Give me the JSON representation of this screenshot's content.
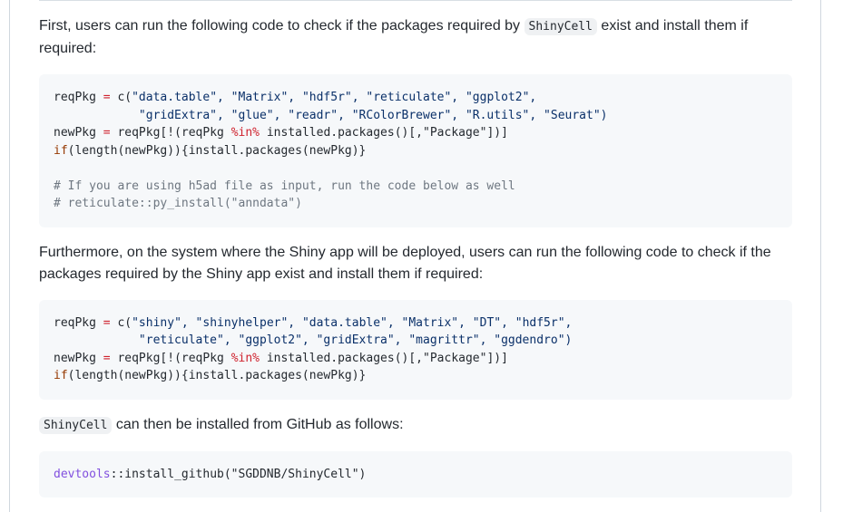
{
  "para1": {
    "before": "First, users can run the following code to check if the packages required by",
    "code": "ShinyCell",
    "after": "exist and install them if required:"
  },
  "block1": {
    "l1_a": "reqPkg",
    "l1_b": " = ",
    "l1_c": "c(",
    "l1_d": "\"data.table\", \"Matrix\", \"hdf5r\", \"reticulate\", \"ggplot2\",",
    "l2": "            \"gridExtra\", \"glue\", \"readr\", \"RColorBrewer\", \"R.utils\", \"Seurat\")",
    "l3_a": "newPkg",
    "l3_b": " = ",
    "l3_c": "reqPkg[!(reqPkg ",
    "l3_d": "%in%",
    "l3_e": " installed.packages()[,\"Package\"])]",
    "l4_a": "if",
    "l4_b": "(length(newPkg)){install.packages(newPkg)}",
    "l6": "# If you are using h5ad file as input, run the code below as well",
    "l7": "# reticulate::py_install(\"anndata\")"
  },
  "para2": {
    "text": "Furthermore, on the system where the Shiny app will be deployed, users can run the following code to check if the packages required by the Shiny app exist and install them if required:"
  },
  "block2": {
    "l1_a": "reqPkg",
    "l1_b": " = ",
    "l1_c": "c(",
    "l1_d": "\"shiny\", \"shinyhelper\", \"data.table\", \"Matrix\", \"DT\", \"hdf5r\",",
    "l2": "            \"reticulate\", \"ggplot2\", \"gridExtra\", \"magrittr\", \"ggdendro\")",
    "l3_a": "newPkg",
    "l3_b": " = ",
    "l3_c": "reqPkg[!(reqPkg ",
    "l3_d": "%in%",
    "l3_e": " installed.packages()[,\"Package\"])]",
    "l4_a": "if",
    "l4_b": "(length(newPkg)){install.packages(newPkg)}"
  },
  "para3": {
    "code": "ShinyCell",
    "after": "can then be installed from GitHub as follows:"
  },
  "block3": {
    "l1_a": "devtools",
    "l1_b": "::install_github(\"SGDDNB/ShinyCell\")"
  }
}
